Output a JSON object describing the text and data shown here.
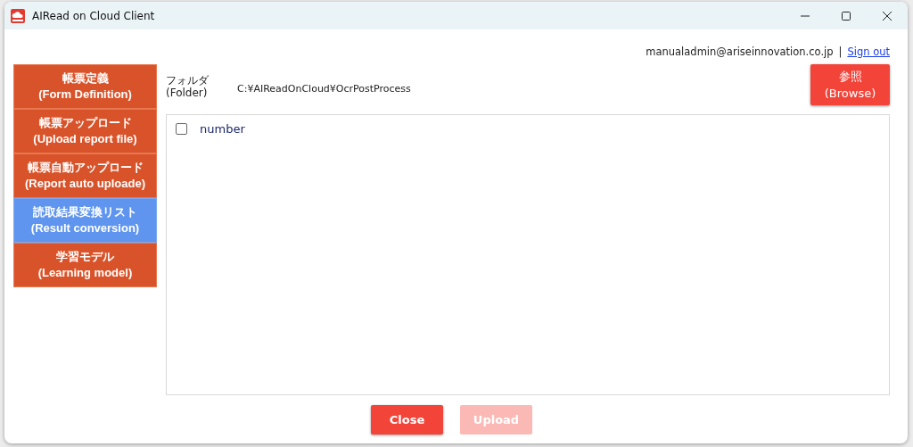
{
  "window": {
    "title": "AIRead on Cloud Client"
  },
  "user": {
    "email": "manualadmin@ariseinnovation.co.jp",
    "separator": "|",
    "sign_out": "Sign out"
  },
  "sidebar": {
    "items": [
      {
        "label": "帳票定義",
        "sublabel": "(Form Definition)",
        "selected": false
      },
      {
        "label": "帳票アップロード",
        "sublabel": "(Upload report file)",
        "selected": false
      },
      {
        "label": "帳票自動アップロード",
        "sublabel": "(Report auto uploade)",
        "selected": false
      },
      {
        "label": "読取結果変換リスト",
        "sublabel": "(Result conversion)",
        "selected": true
      },
      {
        "label": "学習モデル",
        "sublabel": "(Learning model)",
        "selected": false
      }
    ]
  },
  "folder": {
    "label": "フォルダ",
    "sublabel": "(Folder)",
    "path": "C:¥AIReadOnCloud¥OcrPostProcess"
  },
  "browse_button": {
    "label": "参照",
    "sublabel": "(Browse)"
  },
  "list": [
    {
      "label": "number",
      "checked": false
    }
  ],
  "buttons": [
    {
      "label": "Close",
      "disabled": false
    },
    {
      "label": "Upload",
      "disabled": true
    }
  ]
}
